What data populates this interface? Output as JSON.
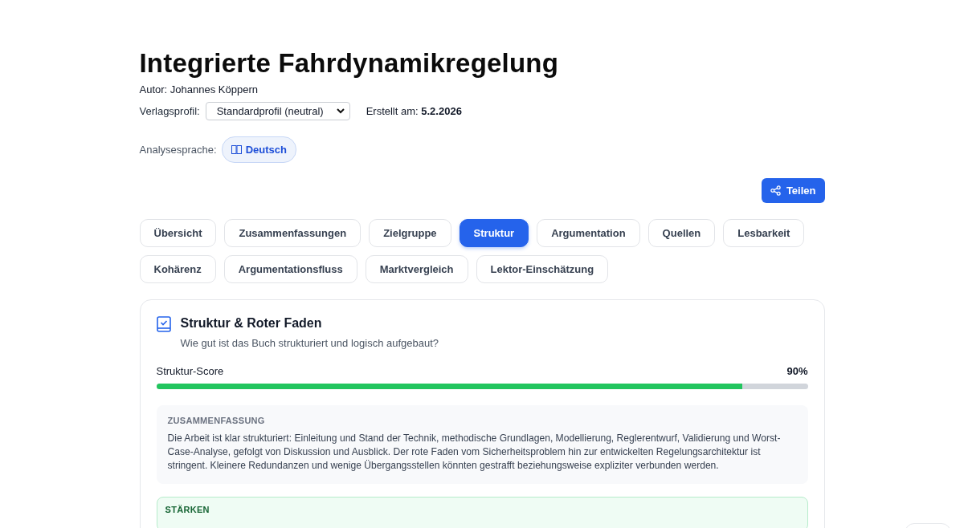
{
  "title": "Integrierte Fahrdynamikregelung",
  "author": "Autor: Johannes Köppern",
  "publisher_profile": {
    "label": "Verlagsprofil:",
    "value": "Standardprofil (neutral)"
  },
  "created": {
    "label": "Erstellt am:",
    "value": "5.2.2026"
  },
  "analysis_language": {
    "label": "Analysesprache:",
    "value": "Deutsch"
  },
  "share_button": "Teilen",
  "tabs": [
    {
      "label": "Übersicht",
      "selected": false
    },
    {
      "label": "Zusammenfassungen",
      "selected": false
    },
    {
      "label": "Zielgruppe",
      "selected": false
    },
    {
      "label": "Struktur",
      "selected": true
    },
    {
      "label": "Argumentation",
      "selected": false
    },
    {
      "label": "Quellen",
      "selected": false
    },
    {
      "label": "Lesbarkeit",
      "selected": false
    },
    {
      "label": "Kohärenz",
      "selected": false
    },
    {
      "label": "Argumentationsfluss",
      "selected": false
    },
    {
      "label": "Marktvergleich",
      "selected": false
    },
    {
      "label": "Lektor-Einschätzung",
      "selected": false
    }
  ],
  "card": {
    "title": "Struktur & Roter Faden",
    "subtitle": "Wie gut ist das Buch strukturiert und logisch aufgebaut?",
    "score": {
      "label": "Struktur-Score",
      "reading": "90%",
      "level": 0.9
    },
    "summary": {
      "heading": "ZUSAMMENFASSUNG",
      "text": "Die Arbeit ist klar strukturiert: Einleitung und Stand der Technik, methodische Grundlagen, Modellierung, Reglerentwurf, Validierung und Worst-Case-Analyse, gefolgt von Diskussion und Ausblick. Der rote Faden vom Sicherheitsproblem hin zur entwickelten Regelungsarchitektur ist stringent. Kleinere Redundanzen und wenige Übergangsstellen könnten gestrafft beziehungsweise expliziter verbunden werden."
    },
    "strengths": {
      "heading": "STÄRKEN"
    }
  }
}
